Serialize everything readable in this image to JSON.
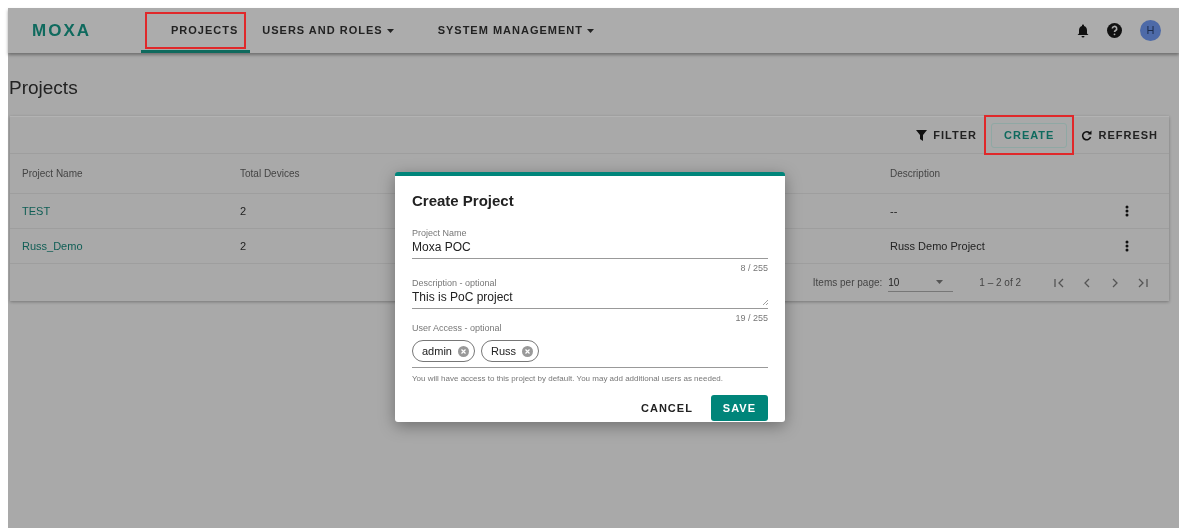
{
  "header": {
    "logo": "MOXA",
    "nav": [
      {
        "label": "PROJECTS",
        "selected": true,
        "highlighted": true,
        "dropdown": false
      },
      {
        "label": "USERS AND ROLES",
        "selected": false,
        "highlighted": false,
        "dropdown": true
      },
      {
        "label": "SYSTEM MANAGEMENT",
        "selected": false,
        "highlighted": false,
        "dropdown": true
      }
    ],
    "avatar": "H"
  },
  "page_title": "Projects",
  "toolbar": [
    {
      "label": "FILTER",
      "kind": "filter",
      "highlighted": false
    },
    {
      "label": "CREATE",
      "kind": "outlined",
      "highlighted": true
    },
    {
      "label": "REFRESH",
      "kind": "refresh",
      "highlighted": false
    }
  ],
  "table": {
    "columns": [
      "Project Name",
      "Total Devices",
      "",
      "",
      "Description"
    ],
    "rows": [
      {
        "name": "TEST",
        "total": "2",
        "description": "--"
      },
      {
        "name": "Russ_Demo",
        "total": "2",
        "description": "Russ Demo Project"
      }
    ]
  },
  "paginator": {
    "label": "Items per page:",
    "page_size": "10",
    "range": "1 – 2 of 2"
  },
  "dialog": {
    "title": "Create Project",
    "name_field": {
      "label": "Project Name",
      "value": "Moxa POC",
      "counter": "8 / 255"
    },
    "description_field": {
      "label": "Description - optional",
      "value": "This is PoC project",
      "counter": "19 / 255"
    },
    "users_field": {
      "label": "User Access - optional",
      "chips": [
        "admin",
        "Russ"
      ],
      "hint": "You will have access to this project by default. You may add additional users as needed."
    },
    "buttons": [
      {
        "label": "CANCEL",
        "kind": "text"
      },
      {
        "label": "SAVE",
        "kind": "primary"
      }
    ]
  }
}
